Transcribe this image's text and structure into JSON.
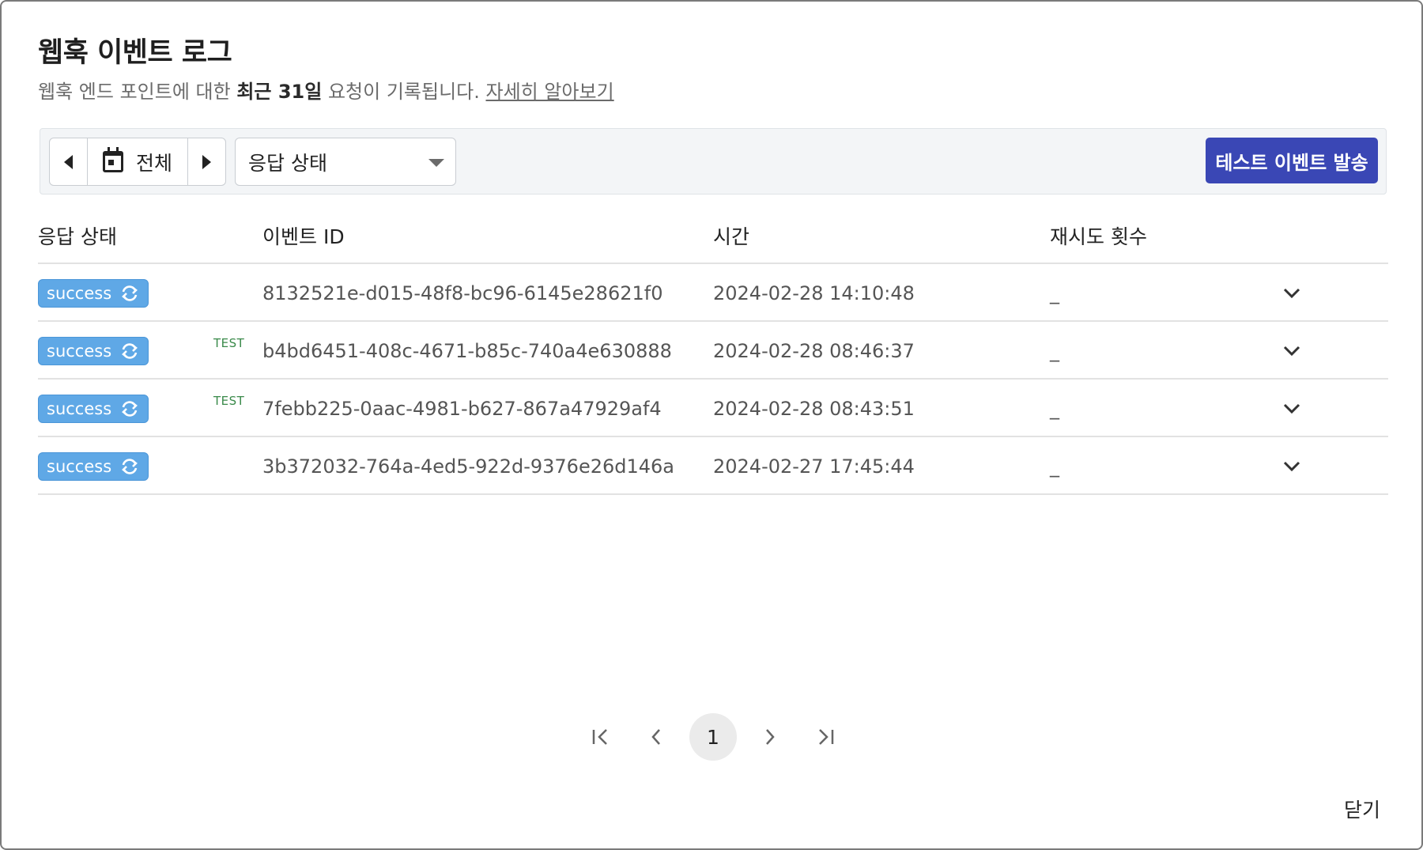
{
  "modal": {
    "title": "웹훅 이벤트 로그",
    "subtitle_pre": "웹훅 엔드 포인트에 대한 ",
    "subtitle_bold": "최근 31일",
    "subtitle_post": " 요청이 기록됩니다. ",
    "learn_more": "자세히 알아보기",
    "close_label": "닫기"
  },
  "toolbar": {
    "date_label": "전체",
    "status_select_value": "응답 상태",
    "test_button_label": "테스트 이벤트 발송"
  },
  "table": {
    "headers": [
      "응답 상태",
      "이벤트 ID",
      "시간",
      "재시도 횟수"
    ],
    "rows": [
      {
        "status": "success",
        "test": "",
        "event_id": "8132521e-d015-48f8-bc96-6145e28621f0",
        "time": "2024-02-28 14:10:48",
        "retries": "_"
      },
      {
        "status": "success",
        "test": "TEST",
        "event_id": "b4bd6451-408c-4671-b85c-740a4e630888",
        "time": "2024-02-28 08:46:37",
        "retries": "_"
      },
      {
        "status": "success",
        "test": "TEST",
        "event_id": "7febb225-0aac-4981-b627-867a47929af4",
        "time": "2024-02-28 08:43:51",
        "retries": "_"
      },
      {
        "status": "success",
        "test": "",
        "event_id": "3b372032-764a-4ed5-922d-9376e26d146a",
        "time": "2024-02-27 17:45:44",
        "retries": "_"
      }
    ]
  },
  "pagination": {
    "current_page": "1"
  },
  "colors": {
    "primary": "#3a47b5",
    "badge": "#5fa8e6",
    "test_tag": "#3a8a4a"
  }
}
